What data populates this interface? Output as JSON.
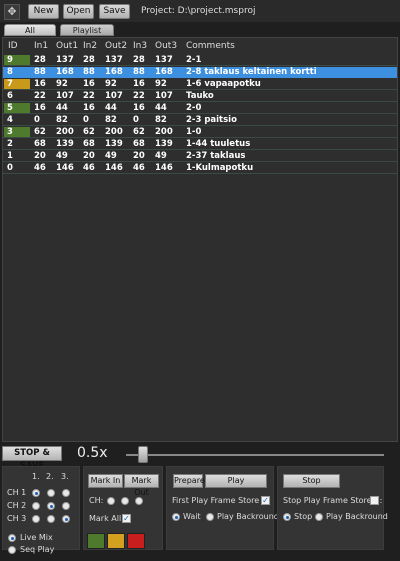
{
  "toolbar": {
    "new": "New",
    "open": "Open",
    "save": "Save",
    "project": "Project: D:\\project.msproj"
  },
  "tabs": {
    "all": "All",
    "playlist": "Playlist"
  },
  "table": {
    "headers": [
      "ID",
      "In1",
      "Out1",
      "In2",
      "Out2",
      "In3",
      "Out3",
      "Comments"
    ],
    "rows": [
      {
        "id": "9",
        "in1": "28",
        "out1": "137",
        "in2": "28",
        "out2": "137",
        "in3": "28",
        "out3": "137",
        "comment": "2-1",
        "id_color": "#4e7a2e",
        "selected": false
      },
      {
        "id": "8",
        "in1": "88",
        "out1": "168",
        "in2": "88",
        "out2": "168",
        "in3": "88",
        "out3": "168",
        "comment": "2-8 taklaus keltainen kortti",
        "id_color": "#3d8fe0",
        "selected": true
      },
      {
        "id": "7",
        "in1": "16",
        "out1": "92",
        "in2": "16",
        "out2": "92",
        "in3": "16",
        "out3": "92",
        "comment": "1-6 vapaapotku",
        "id_color": "#c99a1a",
        "selected": false
      },
      {
        "id": "6",
        "in1": "22",
        "out1": "107",
        "in2": "22",
        "out2": "107",
        "in3": "22",
        "out3": "107",
        "comment": "Tauko",
        "id_color": "",
        "selected": false
      },
      {
        "id": "5",
        "in1": "16",
        "out1": "44",
        "in2": "16",
        "out2": "44",
        "in3": "16",
        "out3": "44",
        "comment": "2-0",
        "id_color": "#4e7a2e",
        "selected": false
      },
      {
        "id": "4",
        "in1": "0",
        "out1": "82",
        "in2": "0",
        "out2": "82",
        "in3": "0",
        "out3": "82",
        "comment": "2-3 paitsio",
        "id_color": "",
        "selected": false
      },
      {
        "id": "3",
        "in1": "62",
        "out1": "200",
        "in2": "62",
        "out2": "200",
        "in3": "62",
        "out3": "200",
        "comment": "1-0",
        "id_color": "#4e7a2e",
        "selected": false
      },
      {
        "id": "2",
        "in1": "68",
        "out1": "139",
        "in2": "68",
        "out2": "139",
        "in3": "68",
        "out3": "139",
        "comment": "1-44 tuuletus",
        "id_color": "",
        "selected": false
      },
      {
        "id": "1",
        "in1": "20",
        "out1": "49",
        "in2": "20",
        "out2": "49",
        "in3": "20",
        "out3": "49",
        "comment": "2-37 taklaus",
        "id_color": "",
        "selected": false
      },
      {
        "id": "0",
        "in1": "46",
        "out1": "146",
        "in2": "46",
        "out2": "146",
        "in3": "46",
        "out3": "146",
        "comment": "1-Kulmapotku",
        "id_color": "",
        "selected": false
      }
    ]
  },
  "controls": {
    "stop_save": "STOP & SAVE",
    "speed": "0.5x",
    "speed_position": 0.06
  },
  "channels": {
    "col_labels": [
      "1.",
      "2.",
      "3."
    ],
    "rows": [
      {
        "label": "CH 1",
        "selected": 0
      },
      {
        "label": "CH 2",
        "selected": 1
      },
      {
        "label": "CH 3",
        "selected": 2
      }
    ],
    "live_mix": "Live Mix",
    "seq_play": "Seq Play",
    "mode": "live"
  },
  "marks": {
    "mark_in": "Mark In",
    "mark_out": "Mark Out",
    "ch_label": "CH:",
    "mark_all": "Mark All:",
    "mark_all_checked": true,
    "swatches": [
      "#4e7a2e",
      "#d4a020",
      "#c81e1e"
    ]
  },
  "play": {
    "prepare": "Prepare",
    "play": "Play",
    "first_frame": "First Play Frame Store A:",
    "first_frame_checked": true,
    "wait": "Wait",
    "play_backround": "Play Backround"
  },
  "stop": {
    "stop": "Stop",
    "stop_frame": "Stop Play Frame Store B:",
    "stop_frame_checked": false,
    "stop_opt": "Stop",
    "play_backround": "Play Backround"
  }
}
